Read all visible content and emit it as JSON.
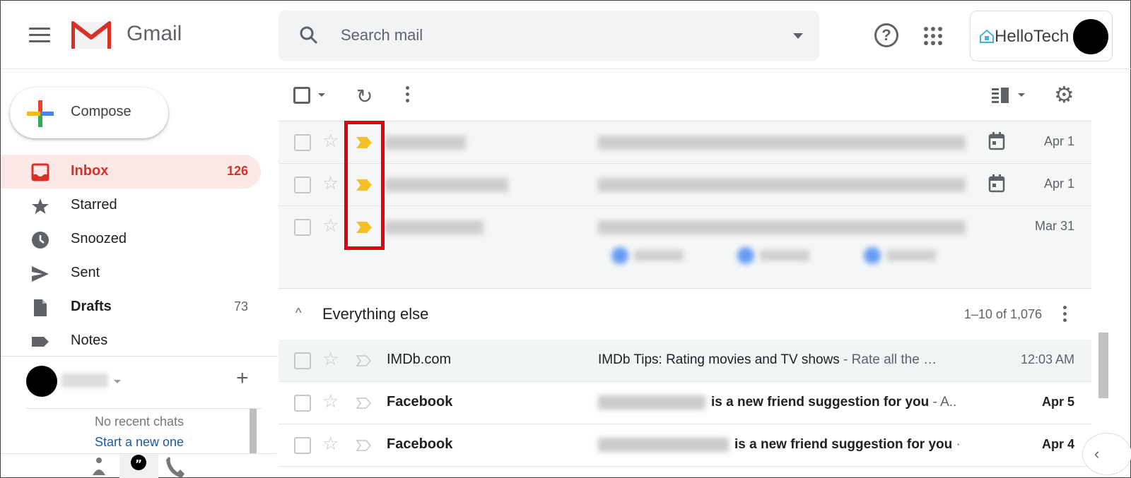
{
  "header": {
    "app_name": "Gmail",
    "search_placeholder": "Search mail",
    "account_brand": "HelloTech"
  },
  "sidebar": {
    "compose_label": "Compose",
    "items": [
      {
        "label": "Inbox",
        "count": "126",
        "icon": "inbox-icon",
        "active": true
      },
      {
        "label": "Starred",
        "count": "",
        "icon": "star-icon"
      },
      {
        "label": "Snoozed",
        "count": "",
        "icon": "clock-icon"
      },
      {
        "label": "Sent",
        "count": "",
        "icon": "send-icon"
      },
      {
        "label": "Drafts",
        "count": "73",
        "icon": "draft-icon",
        "bold": true
      },
      {
        "label": "Notes",
        "count": "",
        "icon": "label-icon"
      }
    ],
    "chat": {
      "empty_text": "No recent chats",
      "start_link": "Start a new one",
      "add_symbol": "+"
    }
  },
  "toolbar": {
    "refresh_glyph": "↻",
    "settings_glyph": "⚙"
  },
  "top_section": {
    "rows": [
      {
        "date": "Apr 1",
        "has_calendar": true,
        "important": true
      },
      {
        "date": "Apr 1",
        "has_calendar": true,
        "important": true
      },
      {
        "date": "Mar 31",
        "has_calendar": false,
        "important": true
      }
    ]
  },
  "everything_else": {
    "title": "Everything else",
    "caret": "^",
    "pagination": "1–10 of 1,076",
    "messages": [
      {
        "sender": "IMDb.com",
        "subject": "IMDb Tips: Rating movies and TV shows",
        "snippet": " - Rate all the …",
        "date": "12:03 AM",
        "unread": false
      },
      {
        "sender": "Facebook",
        "subject": "is a new friend suggestion for you",
        "snippet": " - A..",
        "date": "Apr 5",
        "unread": true
      },
      {
        "sender": "Facebook",
        "subject": "is a new friend suggestion for you",
        "snippet": " ·",
        "date": "Apr 4",
        "unread": true
      }
    ]
  },
  "colors": {
    "accent_red": "#d93025",
    "importance_yellow": "#f4c025",
    "highlight_box": "#e0000f",
    "link_blue": "#1a5aa6"
  }
}
